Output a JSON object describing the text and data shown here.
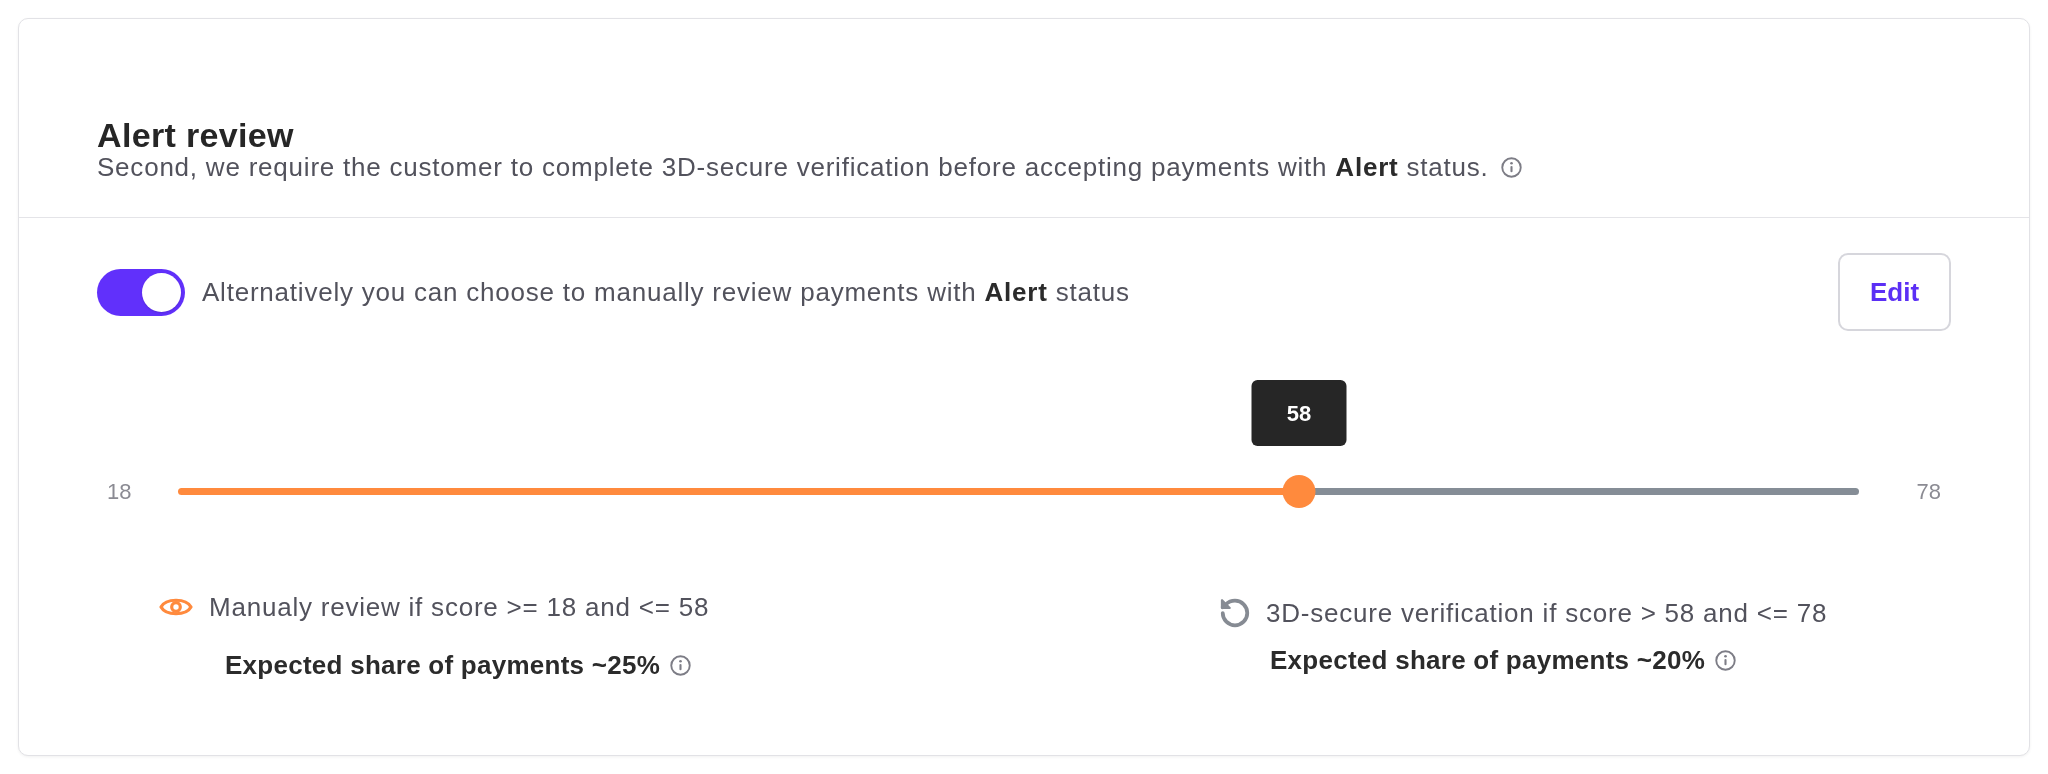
{
  "card": {
    "title": "Alert review",
    "description": "Second, we require the customer to complete 3D-secure verification before accepting payments with **Alert** status."
  },
  "manual_review": {
    "toggle": {
      "on": true
    },
    "label": "Alternatively you can choose to manually review payments with **Alert** status",
    "edit_button": "Edit"
  },
  "slider": {
    "min_label": "18",
    "max_label": "78",
    "value_label": "58",
    "level": 0.667
  },
  "ranges": [
    {
      "kind": "review",
      "label": "Manualy review if score >= 18 and <= 58",
      "share": "Expected share of payments ~25%"
    },
    {
      "kind": "verification",
      "label": "3D-secure verification if score > 58 and <= 78",
      "share": "Expected share of payments ~20%"
    }
  ]
}
